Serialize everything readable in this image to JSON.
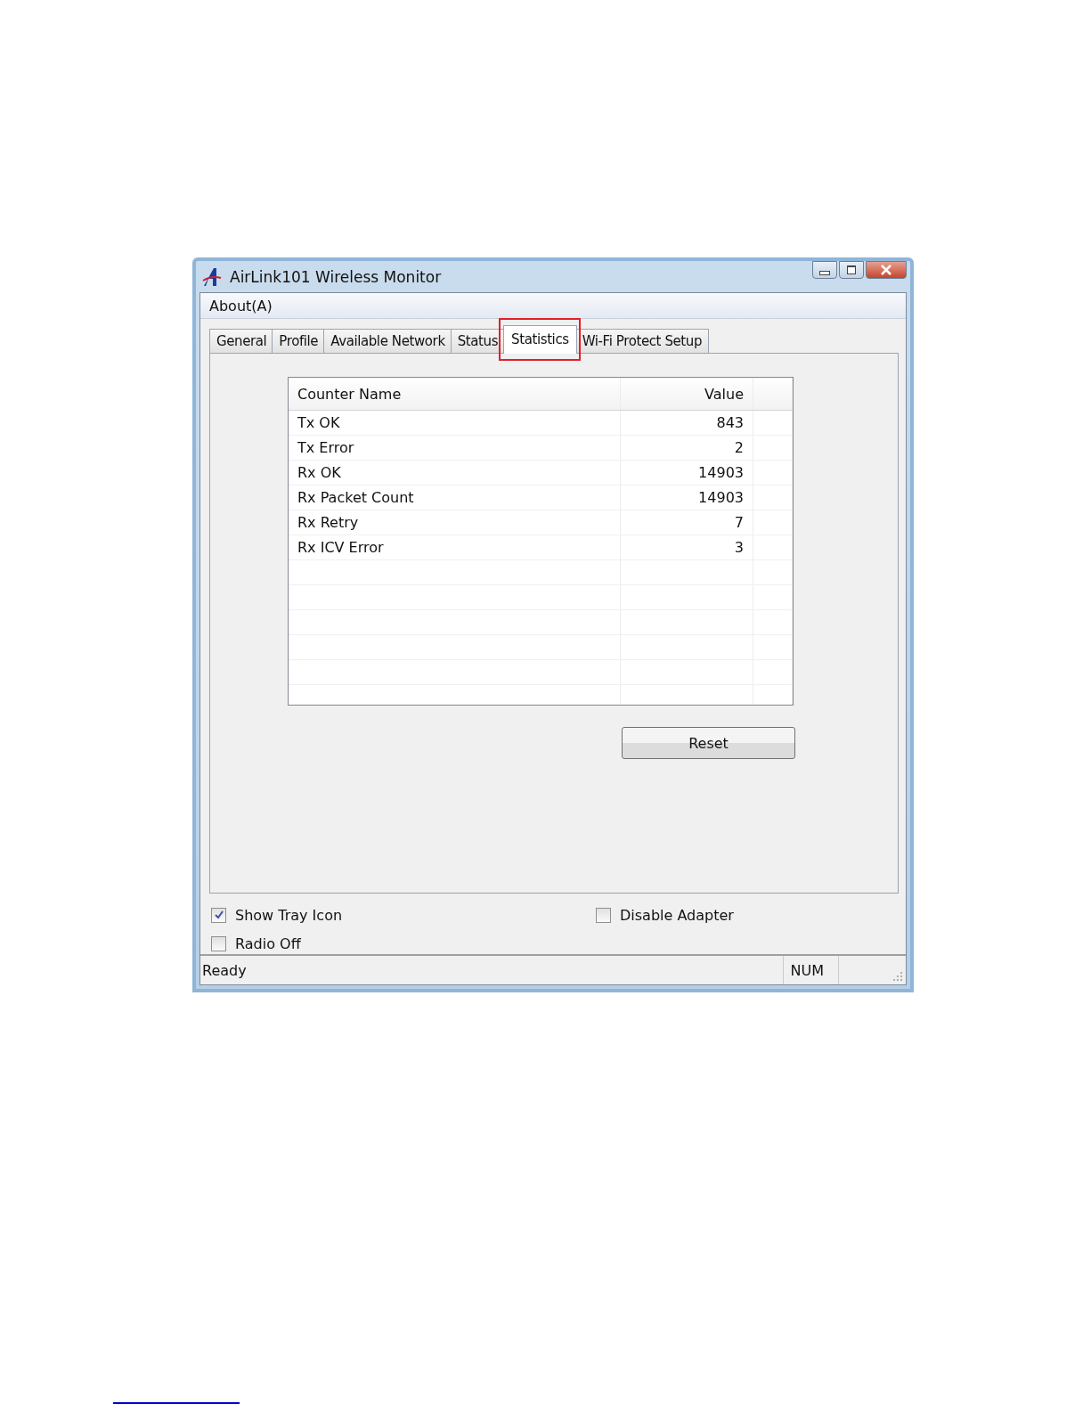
{
  "window": {
    "title": "AirLink101 Wireless Monitor"
  },
  "menu": [
    "About(A)"
  ],
  "tabs": [
    {
      "label": "General",
      "selected": false
    },
    {
      "label": "Profile",
      "selected": false
    },
    {
      "label": "Available Network",
      "selected": false
    },
    {
      "label": "Status",
      "selected": false
    },
    {
      "label": "Statistics",
      "selected": true
    },
    {
      "label": "Wi-Fi Protect Setup",
      "selected": false
    }
  ],
  "table": {
    "columns": [
      "Counter Name",
      "Value"
    ],
    "rows": [
      [
        "Tx OK",
        "843"
      ],
      [
        "Tx Error",
        "2"
      ],
      [
        "Rx OK",
        "14903"
      ],
      [
        "Rx Packet Count",
        "14903"
      ],
      [
        "Rx Retry",
        "7"
      ],
      [
        "Rx ICV Error",
        "3"
      ]
    ]
  },
  "reset_button": "Reset",
  "options": [
    {
      "label": "Show Tray Icon",
      "checked": true
    },
    {
      "label": "Disable Adapter",
      "checked": false
    },
    {
      "label": "Radio Off",
      "checked": false
    }
  ],
  "status_bar": {
    "message": "Ready",
    "indicator": "NUM"
  }
}
